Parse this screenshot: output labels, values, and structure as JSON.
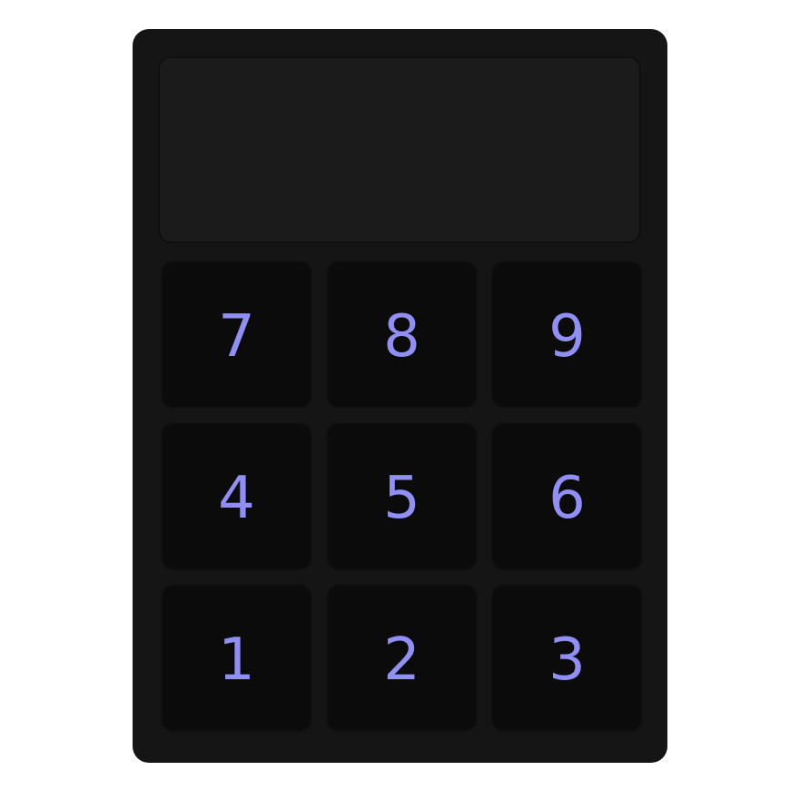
{
  "display": {
    "value": ""
  },
  "keypad": {
    "keys": [
      "7",
      "8",
      "9",
      "4",
      "5",
      "6",
      "1",
      "2",
      "3"
    ]
  },
  "colors": {
    "body": "#151515",
    "display": "#1b1b1b",
    "key": "#0b0b0b",
    "digit": "#8f8ff5"
  }
}
